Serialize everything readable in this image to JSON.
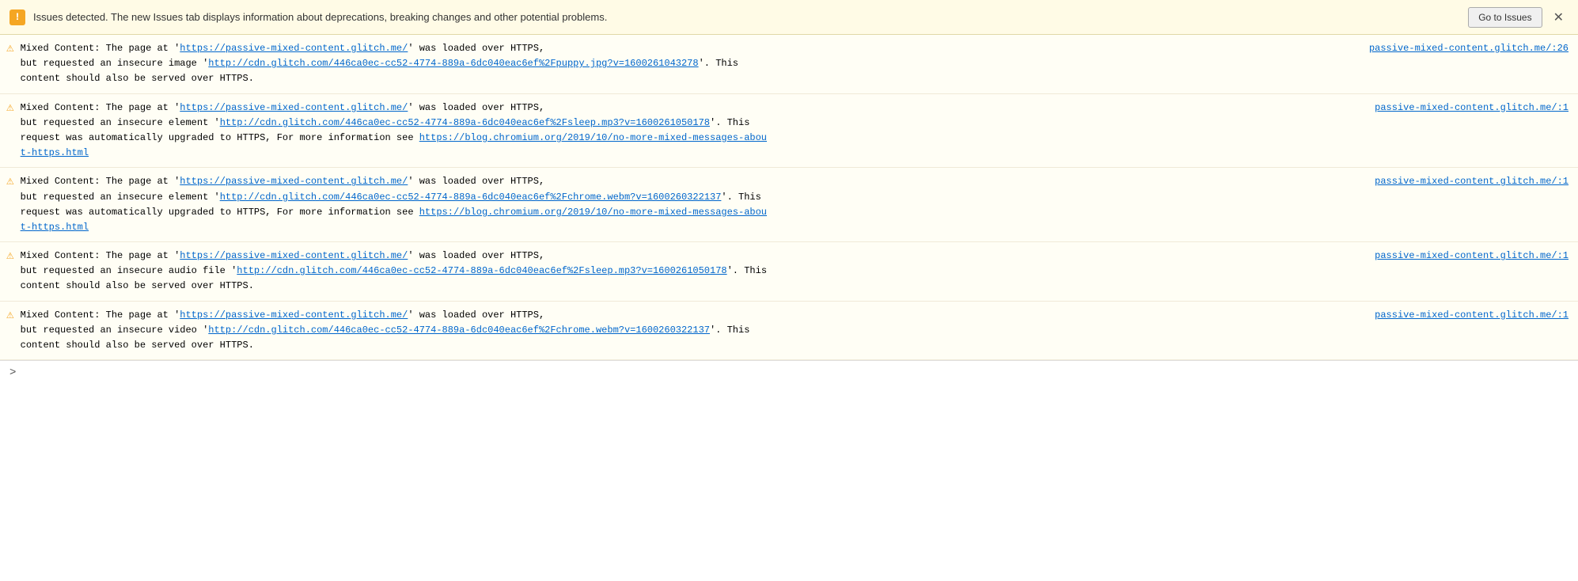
{
  "topbar": {
    "warning_icon": "!",
    "message": "Issues detected. The new Issues tab displays information about deprecations, breaking changes and other potential problems.",
    "goto_btn": "Go to Issues",
    "close_btn": "✕"
  },
  "entries": [
    {
      "source_link": "passive-mixed-content.glitch.me/:26",
      "text_before": "Mixed Content: The page at '",
      "page_url": "https://passive-mixed-content.glitch.me/",
      "text_mid": "' was loaded over HTTPS,",
      "text_after": "but requested an insecure image '",
      "resource_url": "http://cdn.glitch.com/446ca0ec-cc52-4774-889a-6dc040eac6ef%2Fpuppy.jpg?v=1600261043278",
      "text_end": "'. This content should also be served over HTTPS.",
      "extra_link": null,
      "extra_text": null
    },
    {
      "source_link": "passive-mixed-content.glitch.me/:1",
      "text_before": "Mixed Content: The page at '",
      "page_url": "https://passive-mixed-content.glitch.me/",
      "text_mid": "' was loaded over HTTPS,",
      "text_after": "but requested an insecure element '",
      "resource_url": "http://cdn.glitch.com/446ca0ec-cc52-4774-889a-6dc040eac6ef%2Fsleep.mp3?v=1600261050178",
      "text_end": "'. This request was automatically upgraded to HTTPS, For more information see ",
      "extra_link": "https://blog.chromium.org/2019/10/no-more-mixed-messages-about-https.html",
      "extra_text": "https://blog.chromium.org/2019/10/no-more-mixed-messages-about-https.html"
    },
    {
      "source_link": "passive-mixed-content.glitch.me/:1",
      "text_before": "Mixed Content: The page at '",
      "page_url": "https://passive-mixed-content.glitch.me/",
      "text_mid": "' was loaded over HTTPS,",
      "text_after": "but requested an insecure element '",
      "resource_url": "http://cdn.glitch.com/446ca0ec-cc52-4774-889a-6dc040eac6ef%2Fchrome.webm?v=1600260322137",
      "text_end": "'. This request was automatically upgraded to HTTPS, For more information see ",
      "extra_link": "https://blog.chromium.org/2019/10/no-more-mixed-messages-about-https.html",
      "extra_text": "https://blog.chromium.org/2019/10/no-more-mixed-messages-about-https.html"
    },
    {
      "source_link": "passive-mixed-content.glitch.me/:1",
      "text_before": "Mixed Content: The page at '",
      "page_url": "https://passive-mixed-content.glitch.me/",
      "text_mid": "' was loaded over HTTPS,",
      "text_after": "but requested an insecure audio file '",
      "resource_url": "http://cdn.glitch.com/446ca0ec-cc52-4774-889a-6dc040eac6ef%2Fsleep.mp3?v=1600261050178",
      "text_end": "'. This content should also be served over HTTPS.",
      "extra_link": null,
      "extra_text": null
    },
    {
      "source_link": "passive-mixed-content.glitch.me/:1",
      "text_before": "Mixed Content: The page at '",
      "page_url": "https://passive-mixed-content.glitch.me/",
      "text_mid": "' was loaded over HTTPS,",
      "text_after": "but requested an insecure video '",
      "resource_url": "http://cdn.glitch.com/446ca0ec-cc52-4774-889a-6dc040eac6ef%2Fchrome.webm?v=1600260322137",
      "text_end": "'. This content should also be served over HTTPS.",
      "extra_link": null,
      "extra_text": null
    }
  ],
  "bottom": {
    "chevron": ">"
  }
}
